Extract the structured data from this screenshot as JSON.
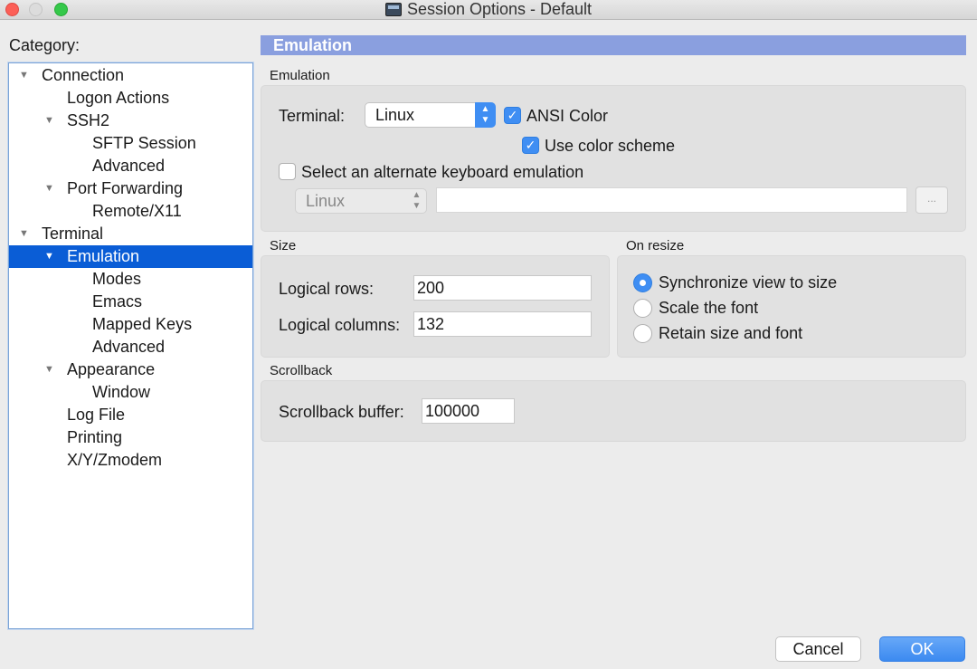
{
  "window": {
    "title": "Session Options - Default"
  },
  "category": {
    "label": "Category:",
    "items": [
      {
        "label": "Connection",
        "level": 0,
        "expanded": true
      },
      {
        "label": "Logon Actions",
        "level": 1
      },
      {
        "label": "SSH2",
        "level": 1,
        "expanded": true
      },
      {
        "label": "SFTP Session",
        "level": 2
      },
      {
        "label": "Advanced",
        "level": 2
      },
      {
        "label": "Port Forwarding",
        "level": 1,
        "expanded": true
      },
      {
        "label": "Remote/X11",
        "level": 2
      },
      {
        "label": "Terminal",
        "level": 0,
        "expanded": true
      },
      {
        "label": "Emulation",
        "level": 1,
        "expanded": true,
        "selected": true
      },
      {
        "label": "Modes",
        "level": 2
      },
      {
        "label": "Emacs",
        "level": 2
      },
      {
        "label": "Mapped Keys",
        "level": 2
      },
      {
        "label": "Advanced",
        "level": 2
      },
      {
        "label": "Appearance",
        "level": 1,
        "expanded": true
      },
      {
        "label": "Window",
        "level": 2
      },
      {
        "label": "Log File",
        "level": 1
      },
      {
        "label": "Printing",
        "level": 1
      },
      {
        "label": "X/Y/Zmodem",
        "level": 1
      }
    ]
  },
  "page": {
    "header": "Emulation"
  },
  "emulation": {
    "group_label": "Emulation",
    "terminal_label": "Terminal:",
    "terminal_value": "Linux",
    "ansi_color_label": "ANSI Color",
    "ansi_color_checked": true,
    "use_color_scheme_label": "Use color scheme",
    "use_color_scheme_checked": true,
    "alt_keyboard_label": "Select an alternate keyboard emulation",
    "alt_keyboard_checked": false,
    "alt_keyboard_value": "Linux",
    "alt_keyboard_path": "",
    "browse_label": "..."
  },
  "size": {
    "group_label": "Size",
    "rows_label": "Logical rows:",
    "rows_value": "200",
    "columns_label": "Logical columns:",
    "columns_value": "132"
  },
  "on_resize": {
    "group_label": "On resize",
    "options": [
      {
        "label": "Synchronize view to size",
        "selected": true
      },
      {
        "label": "Scale the font",
        "selected": false
      },
      {
        "label": "Retain size and font",
        "selected": false
      }
    ]
  },
  "scrollback": {
    "group_label": "Scrollback",
    "buffer_label": "Scrollback buffer:",
    "buffer_value": "100000"
  },
  "buttons": {
    "cancel": "Cancel",
    "ok": "OK"
  },
  "colors": {
    "accent": "#3f8ef3",
    "header_bar": "#8a9fdf",
    "selection": "#0a5dd6"
  }
}
